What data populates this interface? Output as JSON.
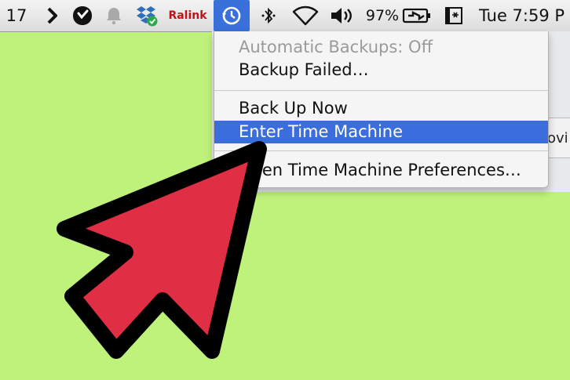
{
  "menubar": {
    "date_fragment": "17",
    "ralink_label": "Ralink",
    "battery_percent": "97%",
    "clock": "Tue 7:59 P"
  },
  "icons": [
    "chevron-right-icon",
    "skype-icon",
    "notification-bell-icon",
    "dropbox-icon",
    "time-machine-icon",
    "bluetooth-icon",
    "wifi-icon",
    "volume-icon",
    "battery-icon",
    "app-menu-icon"
  ],
  "dropdown": {
    "status": "Automatic Backups: Off",
    "failed": "Backup Failed…",
    "back_up_now": "Back Up Now",
    "enter_tm": "Enter Time Machine",
    "preferences": "Open Time Machine Preferences…"
  },
  "background_window": {
    "tab_fragment": "ovi"
  },
  "colors": {
    "background": "#bef27a",
    "arrow_fill": "#e02e44",
    "arrow_stroke": "#000000",
    "highlight": "#3b6ddc"
  }
}
